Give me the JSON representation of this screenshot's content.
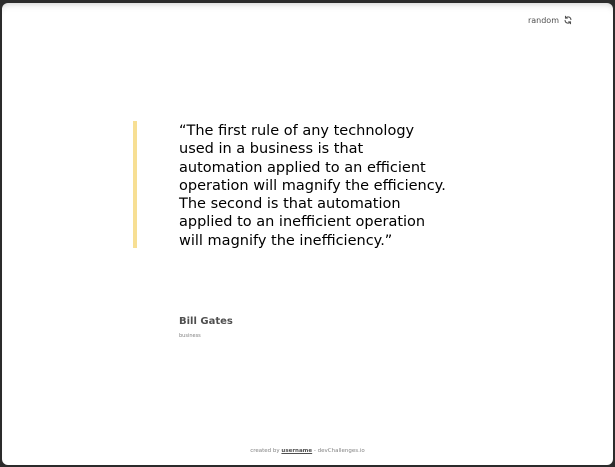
{
  "header": {
    "random_label": "random",
    "random_icon": "refresh-icon"
  },
  "quote": {
    "text": "“The first rule of any technology used in a business is that automation applied to an efficient operation will magnify the efficiency. The second is that automation applied to an inefficient operation will magnify the inefficiency.”",
    "accent_color": "#F7DF94"
  },
  "author": {
    "name": "Bill Gates",
    "genre": "business"
  },
  "footer": {
    "prefix": "created by ",
    "username": "username",
    "suffix": " - devChallenges.io"
  }
}
